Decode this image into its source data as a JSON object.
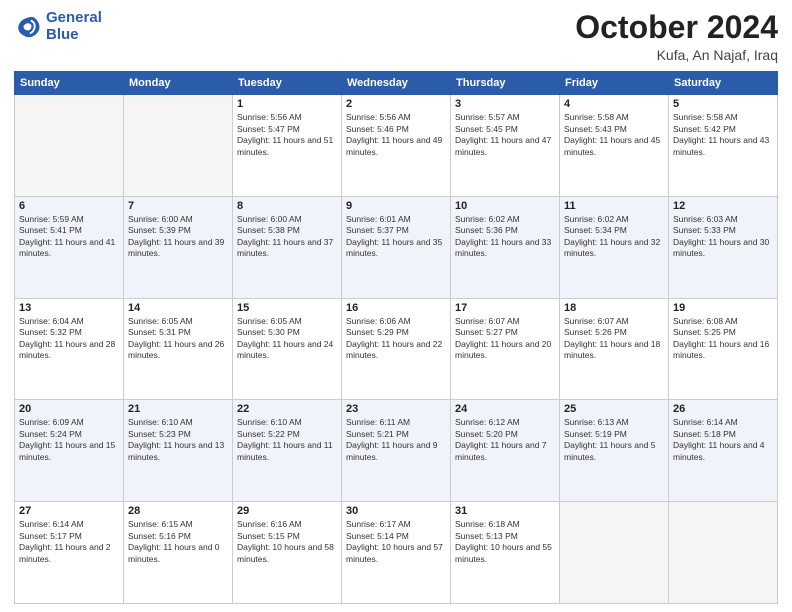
{
  "header": {
    "logo_line1": "General",
    "logo_line2": "Blue",
    "month": "October 2024",
    "location": "Kufa, An Najaf, Iraq"
  },
  "weekdays": [
    "Sunday",
    "Monday",
    "Tuesday",
    "Wednesday",
    "Thursday",
    "Friday",
    "Saturday"
  ],
  "weeks": [
    [
      {
        "day": "",
        "empty": true
      },
      {
        "day": "",
        "empty": true
      },
      {
        "day": "1",
        "sunrise": "5:56 AM",
        "sunset": "5:47 PM",
        "daylight": "11 hours and 51 minutes."
      },
      {
        "day": "2",
        "sunrise": "5:56 AM",
        "sunset": "5:46 PM",
        "daylight": "11 hours and 49 minutes."
      },
      {
        "day": "3",
        "sunrise": "5:57 AM",
        "sunset": "5:45 PM",
        "daylight": "11 hours and 47 minutes."
      },
      {
        "day": "4",
        "sunrise": "5:58 AM",
        "sunset": "5:43 PM",
        "daylight": "11 hours and 45 minutes."
      },
      {
        "day": "5",
        "sunrise": "5:58 AM",
        "sunset": "5:42 PM",
        "daylight": "11 hours and 43 minutes."
      }
    ],
    [
      {
        "day": "6",
        "sunrise": "5:59 AM",
        "sunset": "5:41 PM",
        "daylight": "11 hours and 41 minutes."
      },
      {
        "day": "7",
        "sunrise": "6:00 AM",
        "sunset": "5:39 PM",
        "daylight": "11 hours and 39 minutes."
      },
      {
        "day": "8",
        "sunrise": "6:00 AM",
        "sunset": "5:38 PM",
        "daylight": "11 hours and 37 minutes."
      },
      {
        "day": "9",
        "sunrise": "6:01 AM",
        "sunset": "5:37 PM",
        "daylight": "11 hours and 35 minutes."
      },
      {
        "day": "10",
        "sunrise": "6:02 AM",
        "sunset": "5:36 PM",
        "daylight": "11 hours and 33 minutes."
      },
      {
        "day": "11",
        "sunrise": "6:02 AM",
        "sunset": "5:34 PM",
        "daylight": "11 hours and 32 minutes."
      },
      {
        "day": "12",
        "sunrise": "6:03 AM",
        "sunset": "5:33 PM",
        "daylight": "11 hours and 30 minutes."
      }
    ],
    [
      {
        "day": "13",
        "sunrise": "6:04 AM",
        "sunset": "5:32 PM",
        "daylight": "11 hours and 28 minutes."
      },
      {
        "day": "14",
        "sunrise": "6:05 AM",
        "sunset": "5:31 PM",
        "daylight": "11 hours and 26 minutes."
      },
      {
        "day": "15",
        "sunrise": "6:05 AM",
        "sunset": "5:30 PM",
        "daylight": "11 hours and 24 minutes."
      },
      {
        "day": "16",
        "sunrise": "6:06 AM",
        "sunset": "5:29 PM",
        "daylight": "11 hours and 22 minutes."
      },
      {
        "day": "17",
        "sunrise": "6:07 AM",
        "sunset": "5:27 PM",
        "daylight": "11 hours and 20 minutes."
      },
      {
        "day": "18",
        "sunrise": "6:07 AM",
        "sunset": "5:26 PM",
        "daylight": "11 hours and 18 minutes."
      },
      {
        "day": "19",
        "sunrise": "6:08 AM",
        "sunset": "5:25 PM",
        "daylight": "11 hours and 16 minutes."
      }
    ],
    [
      {
        "day": "20",
        "sunrise": "6:09 AM",
        "sunset": "5:24 PM",
        "daylight": "11 hours and 15 minutes."
      },
      {
        "day": "21",
        "sunrise": "6:10 AM",
        "sunset": "5:23 PM",
        "daylight": "11 hours and 13 minutes."
      },
      {
        "day": "22",
        "sunrise": "6:10 AM",
        "sunset": "5:22 PM",
        "daylight": "11 hours and 11 minutes."
      },
      {
        "day": "23",
        "sunrise": "6:11 AM",
        "sunset": "5:21 PM",
        "daylight": "11 hours and 9 minutes."
      },
      {
        "day": "24",
        "sunrise": "6:12 AM",
        "sunset": "5:20 PM",
        "daylight": "11 hours and 7 minutes."
      },
      {
        "day": "25",
        "sunrise": "6:13 AM",
        "sunset": "5:19 PM",
        "daylight": "11 hours and 5 minutes."
      },
      {
        "day": "26",
        "sunrise": "6:14 AM",
        "sunset": "5:18 PM",
        "daylight": "11 hours and 4 minutes."
      }
    ],
    [
      {
        "day": "27",
        "sunrise": "6:14 AM",
        "sunset": "5:17 PM",
        "daylight": "11 hours and 2 minutes."
      },
      {
        "day": "28",
        "sunrise": "6:15 AM",
        "sunset": "5:16 PM",
        "daylight": "11 hours and 0 minutes."
      },
      {
        "day": "29",
        "sunrise": "6:16 AM",
        "sunset": "5:15 PM",
        "daylight": "10 hours and 58 minutes."
      },
      {
        "day": "30",
        "sunrise": "6:17 AM",
        "sunset": "5:14 PM",
        "daylight": "10 hours and 57 minutes."
      },
      {
        "day": "31",
        "sunrise": "6:18 AM",
        "sunset": "5:13 PM",
        "daylight": "10 hours and 55 minutes."
      },
      {
        "day": "",
        "empty": true
      },
      {
        "day": "",
        "empty": true
      }
    ]
  ]
}
